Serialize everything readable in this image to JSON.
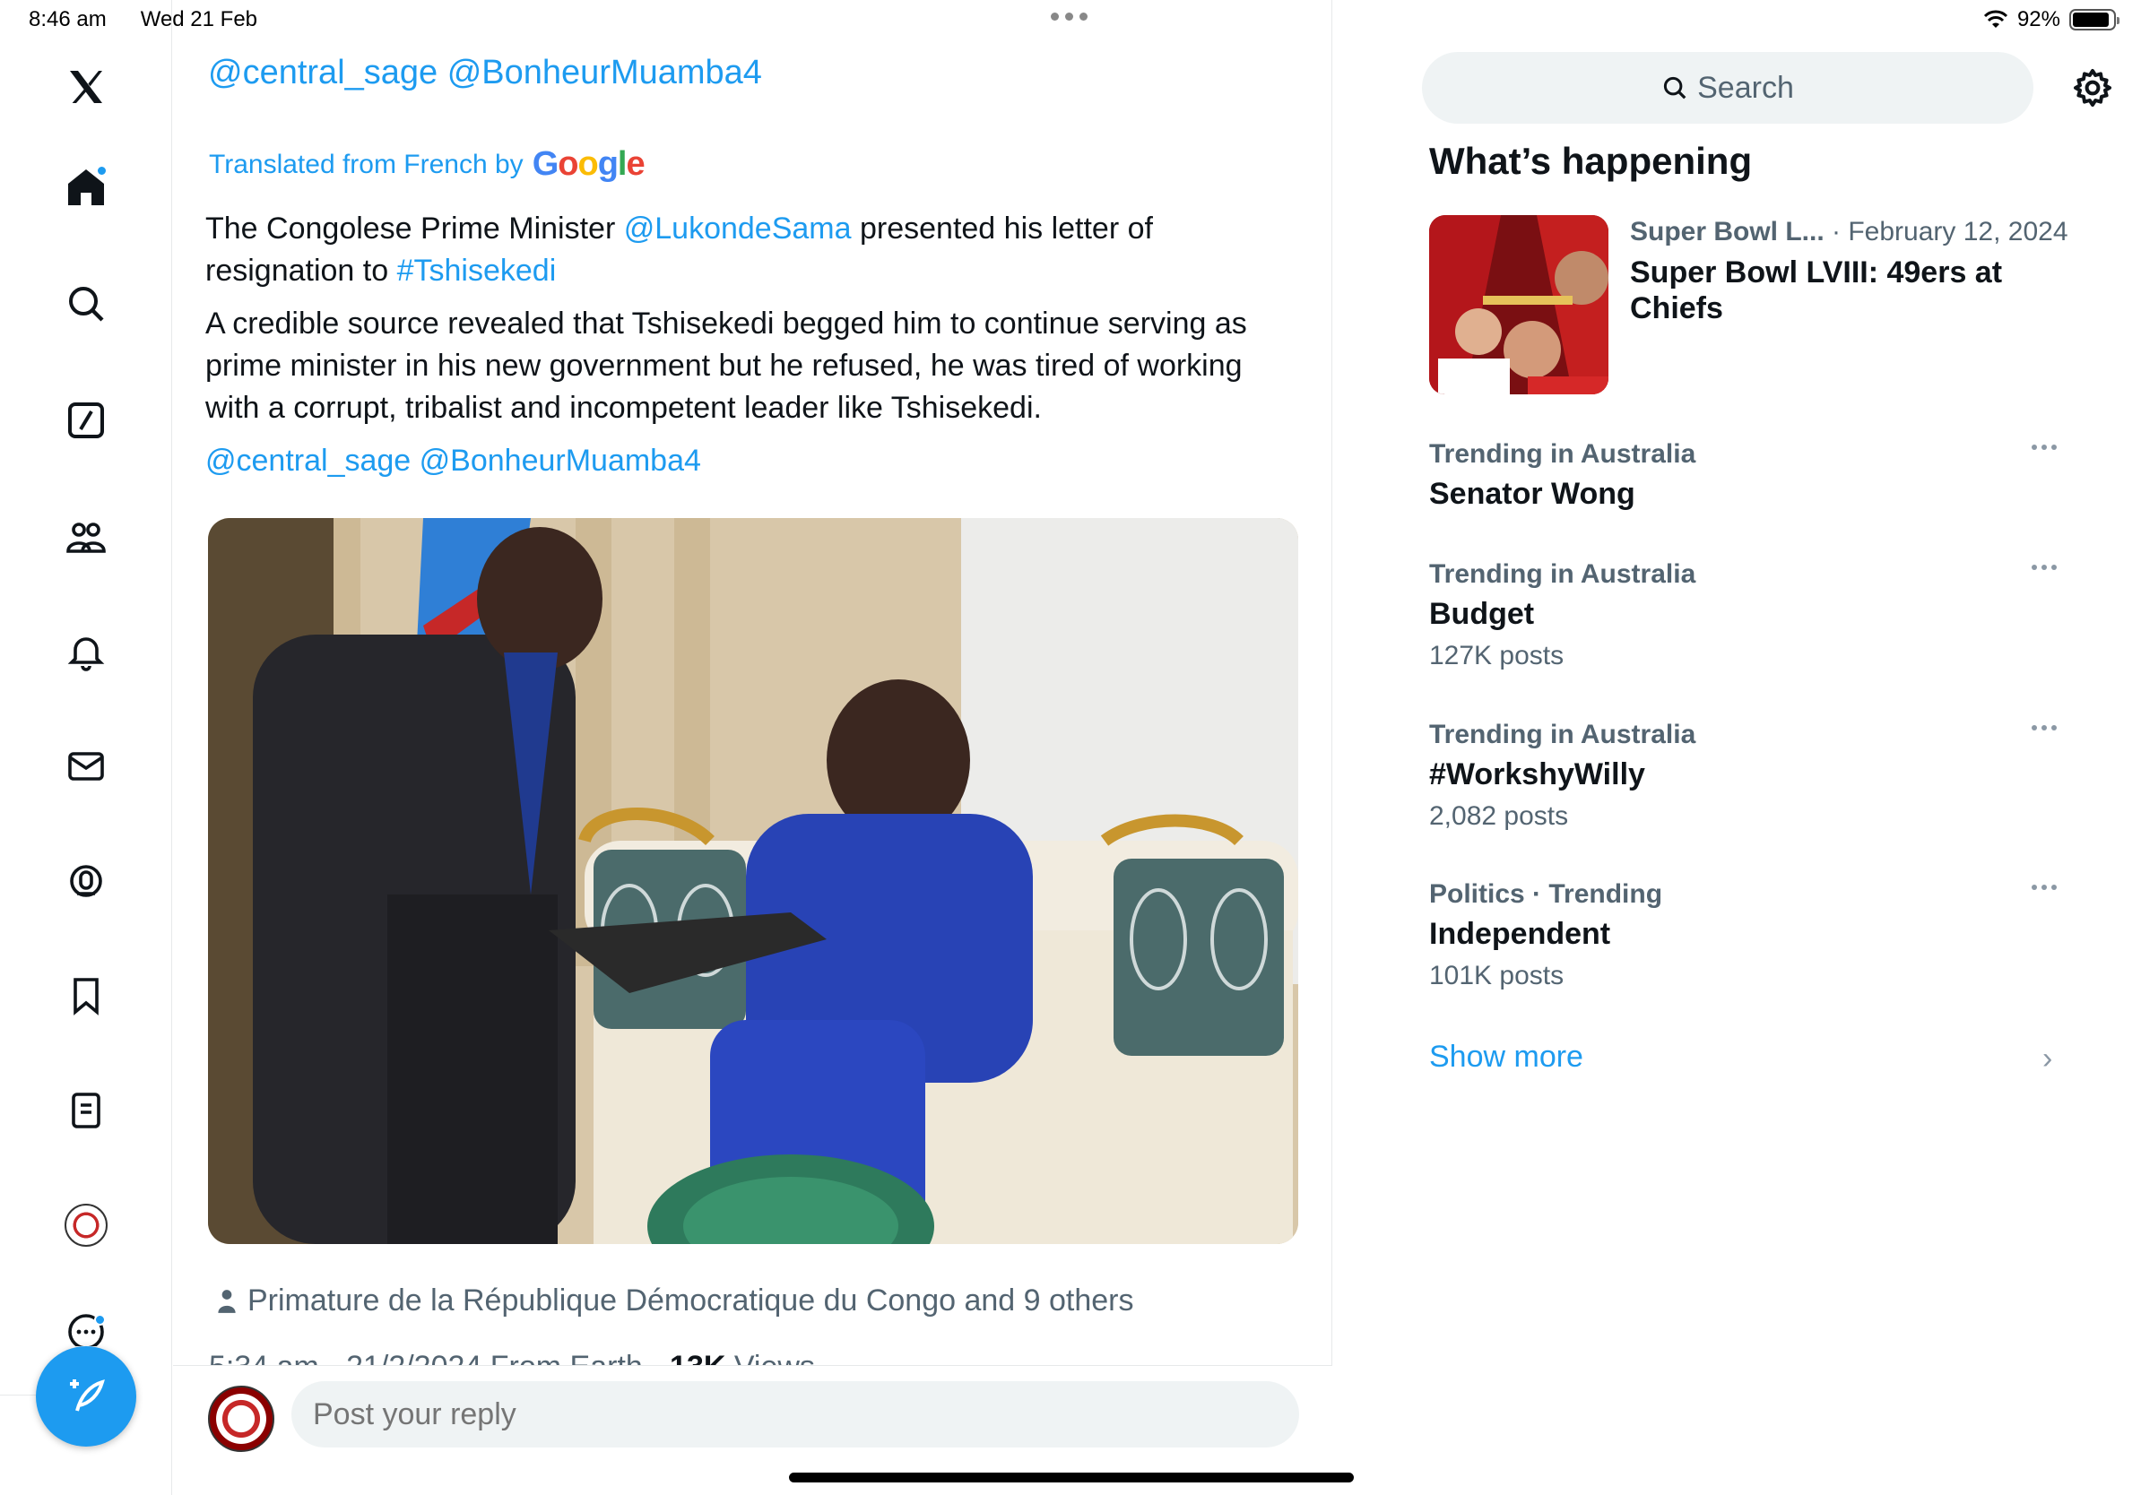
{
  "status_bar": {
    "time": "8:46 am",
    "date": "Wed 21 Feb",
    "battery": "92%",
    "battery_level": 0.92
  },
  "sidebar": {
    "items": [
      {
        "icon": "x-logo-icon"
      },
      {
        "icon": "home-icon",
        "unread": true
      },
      {
        "icon": "search-icon"
      },
      {
        "icon": "grok-icon"
      },
      {
        "icon": "communities-icon"
      },
      {
        "icon": "notifications-icon"
      },
      {
        "icon": "messages-icon"
      },
      {
        "icon": "spaces-icon"
      },
      {
        "icon": "bookmarks-icon"
      },
      {
        "icon": "lists-icon"
      },
      {
        "icon": "profile-avatar"
      },
      {
        "icon": "more-icon",
        "unread": true
      }
    ],
    "compose_icon": "compose-icon"
  },
  "tweet": {
    "mentions_top": "@central_sage @BonheurMuamba4",
    "translated_label": "Translated from French by",
    "translated_brand": "Google",
    "text_p1_before": "The Congolese Prime Minister ",
    "text_p1_mention": "@LukondeSama",
    "text_p1_middle": " presented his letter of resignation to ",
    "text_p1_hashtag": "#Tshisekedi",
    "text_p2": "A credible source revealed that Tshisekedi begged him to continue serving as prime minister in his new government but he refused, he was tired of working with a corrupt, tribalist and incompetent leader like Tshisekedi.",
    "text_p3": "@central_sage @BonheurMuamba4",
    "tagged": "Primature de la République Démocratique du Congo and 9 others",
    "meta_partial": "5:34 am · 21/2/2024 From Earth · ",
    "views_partial": "13K",
    "views_label": " Views"
  },
  "reply": {
    "placeholder": "Post your reply"
  },
  "right": {
    "search_placeholder": "Search",
    "whats_happening": "What’s happening",
    "event": {
      "category": "Super Bowl L...",
      "date": " · February 12, 2024",
      "title": "Super Bowl LVIII: 49ers at Chiefs"
    },
    "trends": [
      {
        "context": "Trending in Australia",
        "name": "Senator Wong",
        "count": ""
      },
      {
        "context": "Trending in Australia",
        "name": "Budget",
        "count": "127K posts"
      },
      {
        "context": "Trending in Australia",
        "name": "#WorkshyWilly",
        "count": "2,082 posts"
      },
      {
        "context": "Politics · Trending",
        "name": "Independent",
        "count": "101K posts"
      }
    ],
    "show_more": "Show more"
  },
  "colors": {
    "accent": "#1d9bf0",
    "text": "#0f1419",
    "muted": "#536471"
  }
}
